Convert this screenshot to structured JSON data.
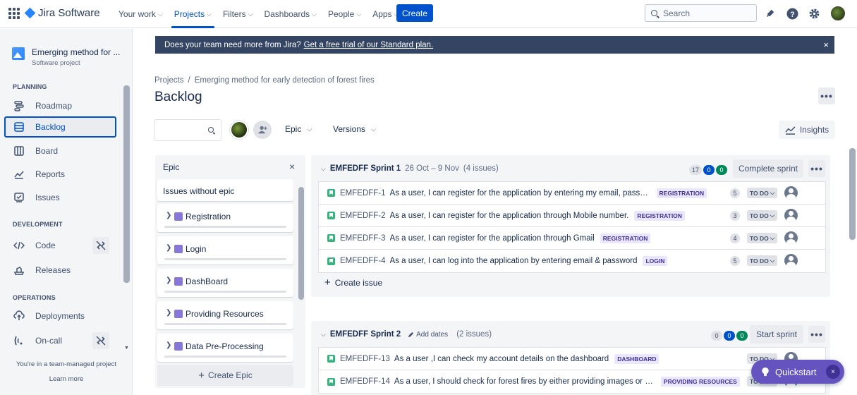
{
  "topnav": {
    "product": "Jira Software",
    "items": [
      {
        "label": "Your work",
        "active": false
      },
      {
        "label": "Projects",
        "active": true
      },
      {
        "label": "Filters",
        "active": false
      },
      {
        "label": "Dashboards",
        "active": false
      },
      {
        "label": "People",
        "active": false
      },
      {
        "label": "Apps",
        "active": false
      }
    ],
    "create_label": "Create",
    "search_placeholder": "Search"
  },
  "sidebar": {
    "project_name": "Emerging method for ...",
    "project_type": "Software project",
    "planning_label": "PLANNING",
    "planning": [
      {
        "label": "Roadmap",
        "icon": "roadmap-icon"
      },
      {
        "label": "Backlog",
        "icon": "backlog-icon",
        "active": true
      },
      {
        "label": "Board",
        "icon": "board-icon"
      },
      {
        "label": "Reports",
        "icon": "reports-icon"
      },
      {
        "label": "Issues",
        "icon": "issues-icon"
      }
    ],
    "development_label": "DEVELOPMENT",
    "development": [
      {
        "label": "Code",
        "icon": "code-icon"
      },
      {
        "label": "Releases",
        "icon": "releases-icon"
      }
    ],
    "operations_label": "OPERATIONS",
    "operations": [
      {
        "label": "Deployments",
        "icon": "deployments-icon"
      },
      {
        "label": "On-call",
        "icon": "on-call-icon"
      }
    ],
    "footer_note": "You're in a team-managed project",
    "learn_more": "Learn more"
  },
  "banner": {
    "text": "Does your team need more from Jira?",
    "link": "Get a free trial of our Standard plan.",
    "close": "×"
  },
  "page": {
    "breadcrumb_root": "Projects",
    "breadcrumb_sep": "/",
    "breadcrumb_project": "Emerging method for early detection of forest fires",
    "title": "Backlog",
    "epic_filter": "Epic",
    "versions_filter": "Versions",
    "insights": "Insights",
    "more": "•••"
  },
  "epic_panel": {
    "title": "Epic",
    "close": "×",
    "without_epic": "Issues without epic",
    "epics": [
      "Registration",
      "Login",
      "DashBoard",
      "Providing Resources",
      "Data Pre-Processing"
    ],
    "create_epic": "Create Epic",
    "color": "#8777d9"
  },
  "sprint1": {
    "name": "EMFEDFF Sprint 1",
    "dates": "26 Oct – 9 Nov",
    "issue_count": "(4 issues)",
    "counts": {
      "todo": "17",
      "in_progress": "0",
      "done": "0"
    },
    "button": "Complete sprint",
    "more": "•••",
    "issues": [
      {
        "key": "EMFEDFF-1",
        "summary": "As a user, I can register for the application by entering my email, password, an...",
        "epic": "REGISTRATION",
        "points": "5",
        "status": "TO DO"
      },
      {
        "key": "EMFEDFF-2",
        "summary": "As a user, I can register for the application through Mobile number.",
        "epic": "REGISTRATION",
        "points": "3",
        "status": "TO DO"
      },
      {
        "key": "EMFEDFF-3",
        "summary": "As a user, I can register for the application through Gmail",
        "epic": "REGISTRATION",
        "points": "4",
        "status": "TO DO"
      },
      {
        "key": "EMFEDFF-4",
        "summary": "As a user, I can log into the application by entering email & password",
        "epic": "LOGIN",
        "points": "5",
        "status": "TO DO"
      }
    ],
    "create_issue": "Create issue"
  },
  "sprint2": {
    "name": "EMFEDFF Sprint 2",
    "add_dates": "Add dates",
    "issue_count": "(2 issues)",
    "counts": {
      "todo": "0",
      "in_progress": "0",
      "done": "0"
    },
    "button": "Start sprint",
    "more": "•••",
    "issues": [
      {
        "key": "EMFEDFF-13",
        "summary": "As a user ,I can check my account details on the dashboard",
        "epic": "DASHBOARD",
        "status": "TO DO"
      },
      {
        "key": "EMFEDFF-14",
        "summary": "As a user, I should check for forest fires by either providing images or Cam...",
        "epic": "PROVIDING RESOURCES",
        "status": "TO DO"
      }
    ]
  },
  "quickstart": {
    "label": "Quickstart",
    "close": "×"
  },
  "colors": {
    "primary": "#0052cc",
    "banner": "#344563",
    "story": "#36b37e",
    "epic_lozenge_bg": "#eae6ff",
    "quickstart": "#6554c0"
  }
}
